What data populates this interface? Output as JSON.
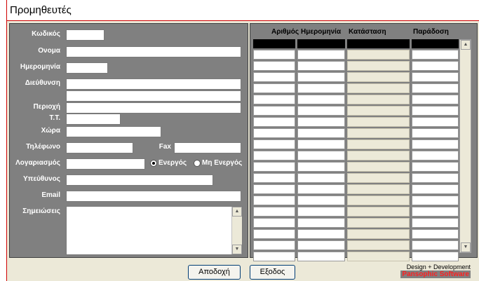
{
  "window": {
    "title": "Προμηθευτές"
  },
  "form": {
    "labels": {
      "code": "Κωδικός",
      "name": "Ονομα",
      "date": "Ημερομηνία",
      "address": "Διεύθυνση",
      "area": "Περιοχή",
      "postcode": "Τ.Τ.",
      "country": "Χώρα",
      "phone": "Τηλέφωνο",
      "fax": "Fax",
      "account": "Λογαριασμός",
      "manager": "Υπεύθυνος",
      "email": "Email",
      "notes": "Σημειώσεις"
    },
    "status": {
      "active": "Ενεργός",
      "inactive": "Μη Ενεργός",
      "selected": "active"
    }
  },
  "grid": {
    "columns": [
      "Αριθμός",
      "Ημερομηνία",
      "Κατάσταση",
      "Παράδοση"
    ],
    "visible_rows": 19
  },
  "buttons": {
    "accept": "Αποδοχή",
    "exit": "Εξοδος"
  },
  "credits": {
    "line1": "Design + Development",
    "line2": "Pansophic Software"
  }
}
